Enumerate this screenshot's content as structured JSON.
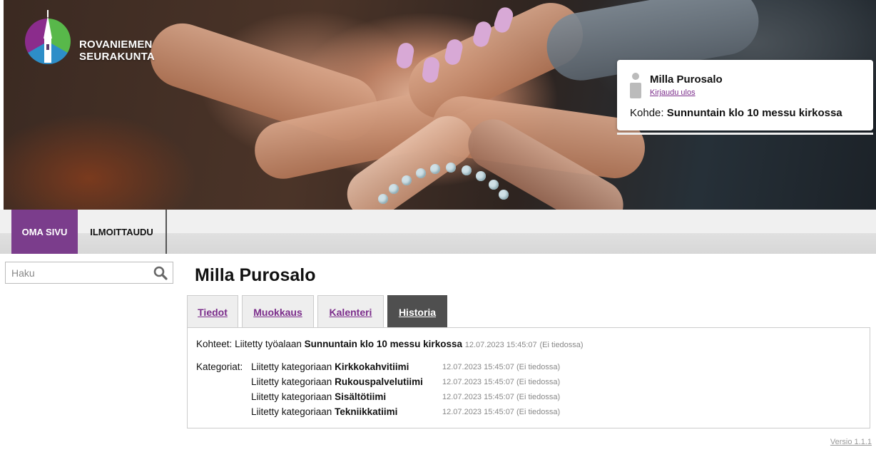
{
  "brand": {
    "line1": "ROVANIEMEN",
    "line2": "SEURAKUNTA",
    "colors": {
      "green": "#58b84a",
      "blue": "#2d8ec8",
      "purple": "#8b2c8c"
    }
  },
  "user": {
    "name": "Milla Purosalo",
    "logout_label": "Kirjaudu ulos",
    "target_label": "Kohde:",
    "target_value": "Sunnuntain klo 10 messu kirkossa"
  },
  "nav": {
    "items": [
      {
        "label": "OMA SIVU",
        "active": true
      },
      {
        "label": "ILMOITTAUDU",
        "active": false
      }
    ],
    "accent": "#7b3d8c"
  },
  "search": {
    "placeholder": "Haku",
    "value": "",
    "icon": "search-icon"
  },
  "main": {
    "title": "Milla Purosalo",
    "tabs": [
      {
        "label": "Tiedot",
        "active": false
      },
      {
        "label": "Muokkaus",
        "active": false
      },
      {
        "label": "Kalenteri",
        "active": false
      },
      {
        "label": "Historia",
        "active": true
      }
    ],
    "history": {
      "targets": {
        "label": "Kohteet:",
        "text": "Liitetty työalaan",
        "name": "Sunnuntain klo 10 messu kirkossa",
        "time": "12.07.2023 15:45:07",
        "author": "(Ei tiedossa)"
      },
      "categories_label": "Kategoriat:",
      "categories": [
        {
          "text": "Liitetty kategoriaan",
          "name": "Kirkkokahvitiimi",
          "time": "12.07.2023 15:45:07",
          "author": "(Ei tiedossa)"
        },
        {
          "text": "Liitetty kategoriaan",
          "name": "Rukouspalvelutiimi",
          "time": "12.07.2023 15:45:07",
          "author": "(Ei tiedossa)"
        },
        {
          "text": "Liitetty kategoriaan",
          "name": "Sisältötiimi",
          "time": "12.07.2023 15:45:07",
          "author": "(Ei tiedossa)"
        },
        {
          "text": "Liitetty kategoriaan",
          "name": "Tekniikkatiimi",
          "time": "12.07.2023 15:45:07",
          "author": "(Ei tiedossa)"
        }
      ]
    }
  },
  "footer": {
    "version": "Versio 1.1.1"
  }
}
